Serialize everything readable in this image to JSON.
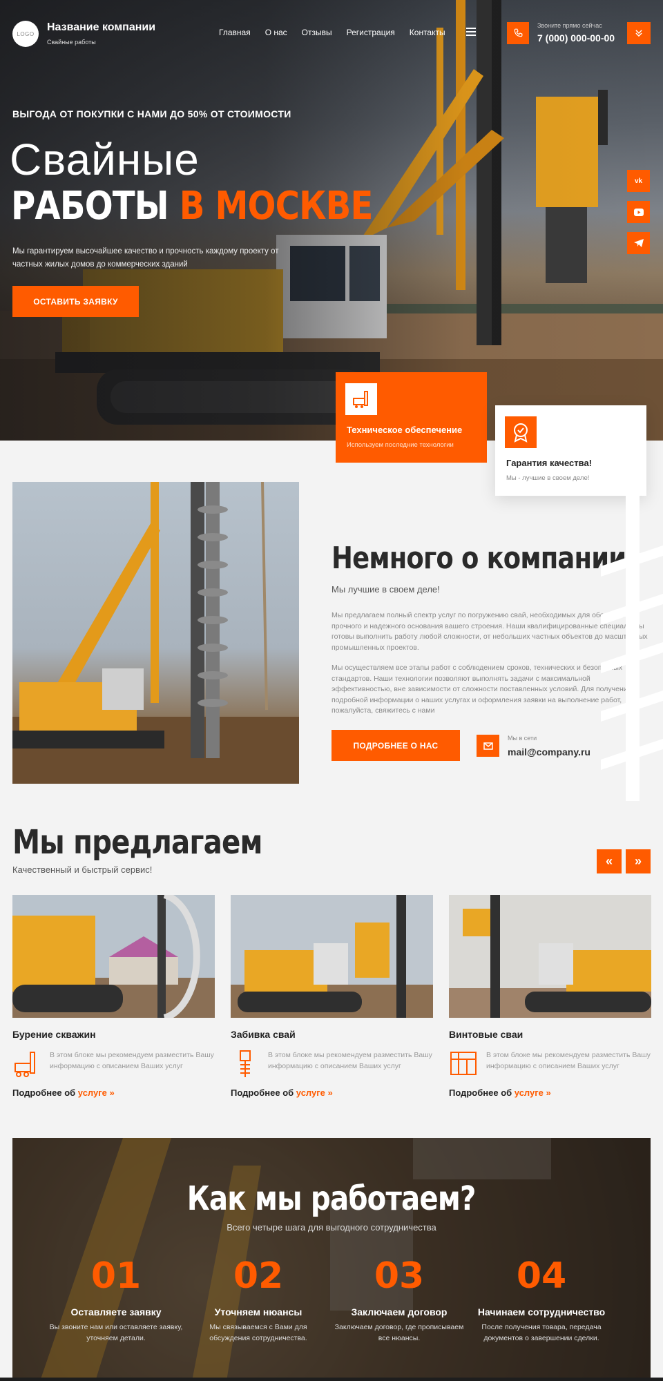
{
  "header": {
    "logo_text": "LOGO",
    "company_name": "Название компании",
    "company_sub": "Свайные работы",
    "nav": [
      "Главная",
      "О нас",
      "Отзывы",
      "Регистрация",
      "Контакты"
    ],
    "phone_label": "Звоните прямо сейчас",
    "phone": "7 (000) 000-00-00"
  },
  "hero": {
    "kicker": "ВЫГОДА ОТ ПОКУПКИ С НАМИ ДО 50% ОТ СТОИМОСТИ",
    "title_line1": "Свайные",
    "title_white": "РАБОТЫ",
    "title_orange": "В МОСКВЕ",
    "description": "Мы гарантируем высочайшее качество и прочность каждому проекту от частных жилых домов до коммерческих зданий",
    "cta": "ОСТАВИТЬ ЗАЯВКУ",
    "social": [
      "vk",
      "youtube",
      "telegram"
    ]
  },
  "features": [
    {
      "title": "Техническое обеспечение",
      "subtitle": "Используем последние технологии"
    },
    {
      "title": "Гарантия качества!",
      "subtitle": "Мы - лучшие в своем деле!"
    }
  ],
  "about": {
    "title": "Немного о компании",
    "subtitle": "Мы лучшие в своем деле!",
    "p1": "Мы предлагаем полный спектр услуг по погружению свай, необходимых для обеспечения прочного и надежного основания вашего строения. Наши квалифицированные специалисты готовы выполнить работу любой сложности, от небольших частных объектов до масштабных промышленных проектов.",
    "p2": "Мы осуществляем все этапы работ с соблюдением сроков, технических и безопасных стандартов. Наши технологии позволяют выполнять задачи с максимальной эффективностью, вне зависимости от сложности поставленных условий. Для получения подробной информации о наших услугах и оформления заявки на выполнение работ, пожалуйста, свяжитесь с нами",
    "button": "ПОДРОБНЕЕ О НАС",
    "mail_label": "Мы в сети",
    "mail": "mail@company.ru"
  },
  "offers": {
    "title": "Мы предлагаем",
    "subtitle": "Качественный и быстрый сервис!",
    "prev": "«",
    "next": "»",
    "items": [
      {
        "name": "Бурение скважин",
        "desc": "В этом блоке мы рекомендуем разместить Вашу информацию с описанием Ваших услуг",
        "more_a": "Подробнее об",
        "more_b": "услуге",
        "more_c": "»"
      },
      {
        "name": "Забивка свай",
        "desc": "В этом блоке мы рекомендуем разместить Вашу информацию с описанием Ваших услуг",
        "more_a": "Подробнее об",
        "more_b": "услуге",
        "more_c": "»"
      },
      {
        "name": "Винтовые сваи",
        "desc": "В этом блоке мы рекомендуем разместить Вашу информацию с описанием Ваших услуг",
        "more_a": "Подробнее об",
        "more_b": "услуге",
        "more_c": "»"
      }
    ]
  },
  "how": {
    "title": "Как мы работаем?",
    "subtitle": "Всего четыре шага для выгодного сотрудничества",
    "steps": [
      {
        "n": "01",
        "title": "Оставляете заявку",
        "desc": "Вы звоните нам или оставляете заявку, уточняем детали."
      },
      {
        "n": "02",
        "title": "Уточняем нюансы",
        "desc": "Мы связываемся с Вами для обсуждения сотрудничества."
      },
      {
        "n": "03",
        "title": "Заключаем договор",
        "desc": "Заключаем договор, где прописываем все нюансы."
      },
      {
        "n": "04",
        "title": "Начинаем сотрудничество",
        "desc": "После получения товара, передача документов о завершении сделки."
      }
    ]
  },
  "colors": {
    "accent": "#ff5b00",
    "dark": "#2a2a2a",
    "bg": "#f3f3f3"
  }
}
